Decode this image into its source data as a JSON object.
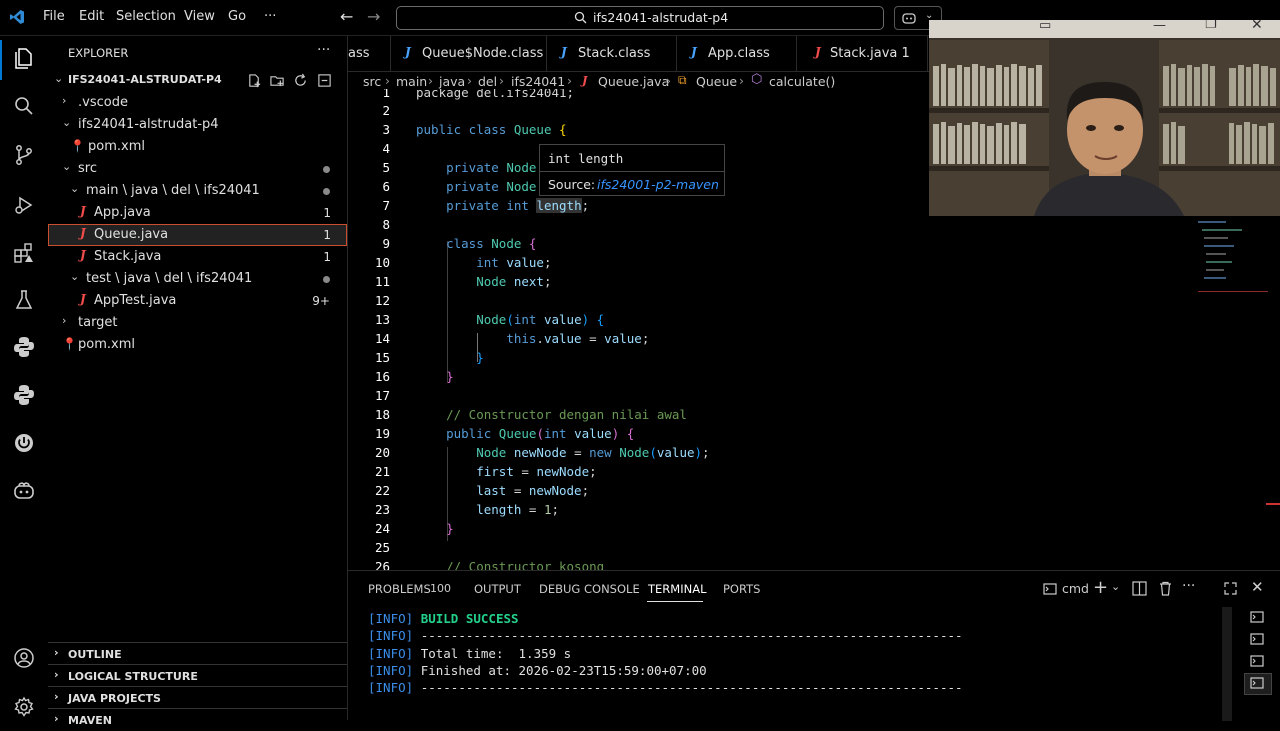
{
  "titlebar": {
    "menus": [
      "File",
      "Edit",
      "Selection",
      "View",
      "Go",
      "···"
    ],
    "search": "ifs24041-alstrudat-p4",
    "nav_back": "←",
    "nav_forward": "→"
  },
  "explorer": {
    "title": "EXPLORER",
    "more": "···",
    "root": "IFS24041-ALSTRUDAT-P4",
    "items": [
      {
        "label": ".vscode",
        "badge": ""
      },
      {
        "label": "ifs24041-alstrudat-p4",
        "badge": ""
      },
      {
        "label": "pom.xml",
        "badge": ""
      },
      {
        "label": "src",
        "badge": ""
      },
      {
        "label": "main \\ java \\ del \\ ifs24041",
        "badge": ""
      },
      {
        "label": "App.java",
        "badge": "1"
      },
      {
        "label": "Queue.java",
        "badge": "1"
      },
      {
        "label": "Stack.java",
        "badge": "1"
      },
      {
        "label": "test \\ java \\ del \\ ifs24041",
        "badge": ""
      },
      {
        "label": "AppTest.java",
        "badge": "9+"
      },
      {
        "label": "target",
        "badge": ""
      },
      {
        "label": "pom.xml",
        "badge": ""
      }
    ],
    "panels": [
      "OUTLINE",
      "LOGICAL STRUCTURE",
      "JAVA PROJECTS",
      "MAVEN"
    ]
  },
  "tabs": [
    {
      "label": "ass",
      "icon": ""
    },
    {
      "label": "Queue$Node.class",
      "icon": "J"
    },
    {
      "label": "Stack.class",
      "icon": "J"
    },
    {
      "label": "App.class",
      "icon": "J"
    },
    {
      "label": "Stack.java 1",
      "icon": "J"
    }
  ],
  "breadcrumb": {
    "parts": [
      "src",
      "main",
      "java",
      "del",
      "ifs24041",
      "Queue.java",
      "Queue",
      "calculate()"
    ],
    "sep": "›"
  },
  "code": {
    "line_numbers": [
      "1",
      "2",
      "3",
      "4",
      "5",
      "6",
      "7",
      "8",
      "9",
      "10",
      "11",
      "12",
      "13",
      "14",
      "15",
      "16",
      "17",
      "18",
      "19",
      "20",
      "21",
      "22",
      "23",
      "24",
      "25",
      "26"
    ],
    "line1": "package del.ifs24041;",
    "l3_kw": "public class",
    "l3_name": "Queue",
    "l5_kw": "private",
    "l5_type": "Node",
    "l7_kw": "private int",
    "l7_var": "length",
    "l9_kw": "class",
    "l9_name": "Node",
    "l10_kw": "int",
    "l10_var": "value",
    "l11_type": "Node",
    "l11_var": "next",
    "l13_fn": "Node",
    "l13_kw": "int",
    "l13_var": "value",
    "l14_kw": "this",
    "l14_rest": "value",
    "l18_comment": "// Constructor dengan nilai awal",
    "l19_kw": "public",
    "l19_fn": "Queue",
    "l19_kw2": "int",
    "l19_var": "value",
    "l20_type": "Node",
    "l20_var": "newNode",
    "l20_kw": "new",
    "l20_fn": "Node",
    "l20_arg": "value",
    "l21_var": "first",
    "l21_val": "newNode",
    "l22_var": "last",
    "l22_val": "newNode",
    "l23_var": "length",
    "l23_num": "1",
    "l26_comment": "// Constructor kosong"
  },
  "hover": {
    "signature": "int length",
    "source_label": "Source:",
    "source_value": "ifs24001-p2-maven"
  },
  "panel": {
    "tabs": [
      {
        "label": "PROBLEMS",
        "count": "100"
      },
      {
        "label": "OUTPUT",
        "count": ""
      },
      {
        "label": "DEBUG CONSOLE",
        "count": ""
      },
      {
        "label": "TERMINAL",
        "count": ""
      },
      {
        "label": "PORTS",
        "count": ""
      }
    ],
    "shell": "cmd",
    "terminal": [
      {
        "tag": "[INFO]",
        "text": "BUILD SUCCESS"
      },
      {
        "tag": "[INFO]",
        "text": "------------------------------------------------------------------------"
      },
      {
        "tag": "[INFO]",
        "text": "Total time:  1.359 s"
      },
      {
        "tag": "[INFO]",
        "text": "Finished at: 2026-02-23T15:59:00+07:00"
      },
      {
        "tag": "[INFO]",
        "text": "------------------------------------------------------------------------"
      }
    ]
  },
  "colors": {
    "accent": "#0078d4",
    "java_icon": "#f14c4c",
    "keyword": "#569cd6",
    "type": "#4ec9b0"
  }
}
